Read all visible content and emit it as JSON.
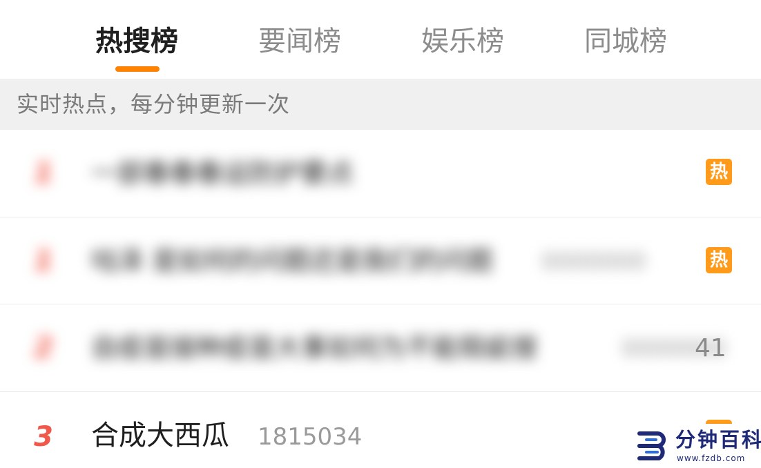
{
  "tabs": [
    {
      "label": "热搜榜",
      "active": true
    },
    {
      "label": "要闻榜",
      "active": false
    },
    {
      "label": "娱乐榜",
      "active": false
    },
    {
      "label": "同城榜",
      "active": false
    }
  ],
  "accent_color": "#ff8200",
  "subheader": "实时热点，每分钟更新一次",
  "list": [
    {
      "rank": "1",
      "title": "一部春春春运防护要点",
      "count": "",
      "badge": "热",
      "blurred": true
    },
    {
      "rank": "1",
      "title": "咕泽 是如何的问题还是我们的问题",
      "count": "0000000",
      "badge": "热",
      "blurred": true
    },
    {
      "rank": "2",
      "title": "自疫苗接种疫苗大事如何为不能瑕疵搜",
      "count": "0000000",
      "count_tail": "41",
      "blurred": true
    },
    {
      "rank": "3",
      "title": "合成大西瓜",
      "count": "1815034",
      "blurred": false
    }
  ],
  "watermark": {
    "name": "分钟百科",
    "url": "www.fzdb.com",
    "icon": "fzdb-logo-icon"
  }
}
